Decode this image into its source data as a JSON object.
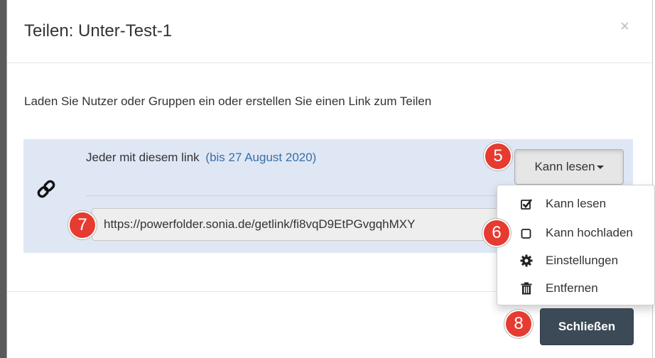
{
  "dialog": {
    "title": "Teilen: Unter-Test-1",
    "close_symbol": "×",
    "intro": "Laden Sie Nutzer oder Gruppen ein oder erstellen Sie einen Link zum Teilen"
  },
  "share_link": {
    "label": "Jeder mit diesem link",
    "expiry": "(bis 27 August 2020)",
    "url": "https://powerfolder.sonia.de/getlink/fi8vqD9EtPGvgqhMXY",
    "permission_button": "Kann lesen",
    "icon": "link-icon"
  },
  "dropdown": {
    "items": [
      {
        "label": "Kann lesen",
        "icon": "checkbox-checked-icon"
      },
      {
        "label": "Kann hochladen",
        "icon": "checkbox-empty-icon"
      },
      {
        "label": "Einstellungen",
        "icon": "gear-icon"
      },
      {
        "label": "Entfernen",
        "icon": "trash-icon"
      }
    ]
  },
  "footer": {
    "close_button": "Schließen"
  },
  "badges": {
    "b5": "5",
    "b6": "6",
    "b7": "7",
    "b8": "8"
  },
  "colors": {
    "panel_bg": "#dfe7f5",
    "expiry_text": "#3b6ea5",
    "primary_button": "#3c4a57",
    "badge": "#e63b30"
  }
}
